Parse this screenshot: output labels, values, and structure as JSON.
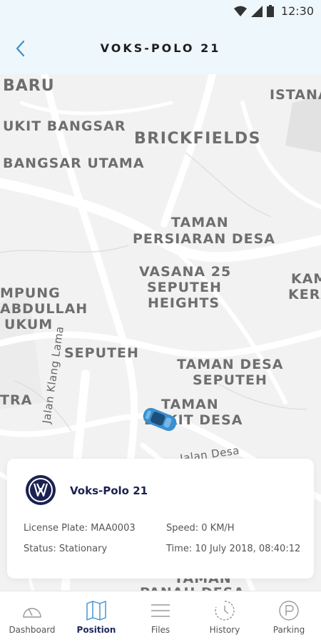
{
  "status_bar": {
    "time": "12:30"
  },
  "header": {
    "title": "VOKS-POLO 21"
  },
  "map_labels": [
    "BARU",
    "ISTANA",
    "UKIT BANGSAR",
    "BRICKFIELDS",
    "BANGSAR UTAMA",
    "TAMAN",
    "PERSIARAN DESA",
    "VASANA 25",
    "SEPUTEH",
    "HEIGHTS",
    "MPUNG",
    "ABDULLAH",
    "UKUM",
    "KAM",
    "KERA",
    "SEPUTEH",
    "TAMAN DESA",
    "SEPUTEH",
    "TRA",
    "TAMAN",
    "BUKIT DESA",
    "Jalan Klang Lama",
    "Jalan Desa",
    "TAMAN",
    "PANAH DESA"
  ],
  "vehicle": {
    "name": "Voks-Polo 21",
    "license_plate": "License Plate: MAA0003",
    "speed": "Speed: 0 KM/H",
    "status": "Status: Stationary",
    "time": "Time: 10 July 2018, 08:40:12"
  },
  "nav": {
    "items": [
      {
        "label": "Dashboard",
        "icon": "dashboard-gauge-icon",
        "active": false
      },
      {
        "label": "Position",
        "icon": "map-icon",
        "active": true
      },
      {
        "label": "Files",
        "icon": "menu-lines-icon",
        "active": false
      },
      {
        "label": "History",
        "icon": "history-clock-icon",
        "active": false
      },
      {
        "label": "Parking",
        "icon": "parking-icon",
        "active": false
      }
    ]
  },
  "colors": {
    "accent": "#3a8fd0",
    "nav_active": "#1f2a5c",
    "car": "#3a8fd0"
  }
}
